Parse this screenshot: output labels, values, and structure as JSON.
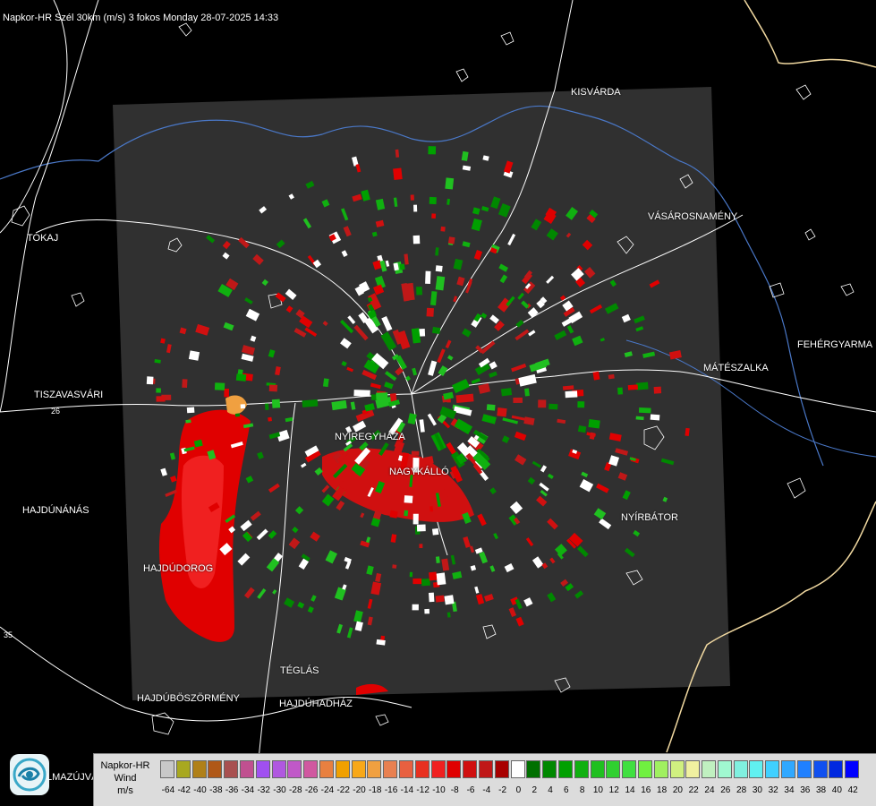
{
  "header": {
    "title": "Napkor-HR Szél 30km (m/s) 3 fokos Monday 28-07-2025 14:33"
  },
  "cities": [
    {
      "id": "kisvarda",
      "label": "KISVÁRDA"
    },
    {
      "id": "tokaj",
      "label": "TOKAJ"
    },
    {
      "id": "vasarosnameny",
      "label": "VÁSÁROSNAMÉNY"
    },
    {
      "id": "fehergyarmat",
      "label": "FEHÉRGYARMA"
    },
    {
      "id": "mateszalka",
      "label": "MÁTÉSZALKA"
    },
    {
      "id": "tiszavasvari",
      "label": "TISZAVASVÁRI"
    },
    {
      "id": "nyiregyhaza",
      "label": "NYÍREGYHÁZA"
    },
    {
      "id": "nagykallo",
      "label": "NAGYKÁLLÓ"
    },
    {
      "id": "hajdunanas",
      "label": "HAJDÚNÁNÁS"
    },
    {
      "id": "nyirbator",
      "label": "NYÍRBÁTOR"
    },
    {
      "id": "hajdudorog",
      "label": "HAJDÚDOROG"
    },
    {
      "id": "teglas",
      "label": "TÉGLÁS"
    },
    {
      "id": "hajduboszormeny",
      "label": "HAJDÚBÖSZÖRMÉNY"
    },
    {
      "id": "hajduhadhaz",
      "label": "HAJDÚHADHÁZ"
    }
  ],
  "road_numbers": [
    "26",
    "35"
  ],
  "legend": {
    "title_lines": [
      "Napkor-HR",
      "Wind",
      "m/s"
    ],
    "ticks": [
      "-64",
      "-42",
      "-40",
      "-38",
      "-36",
      "-34",
      "-32",
      "-30",
      "-28",
      "-26",
      "-24",
      "-22",
      "-20",
      "-18",
      "-16",
      "-14",
      "-12",
      "-10",
      "-8",
      "-6",
      "-4",
      "-2",
      "0",
      "2",
      "4",
      "6",
      "8",
      "10",
      "12",
      "14",
      "16",
      "18",
      "20",
      "22",
      "24",
      "26",
      "28",
      "30",
      "32",
      "34",
      "36",
      "38",
      "40",
      "42"
    ],
    "colors": [
      "#c8c8c8",
      "#a8a820",
      "#b08018",
      "#b05818",
      "#a85050",
      "#c05090",
      "#a050f0",
      "#b058e0",
      "#c058c8",
      "#d058a0",
      "#e88040",
      "#f0a000",
      "#f8a818",
      "#f0a040",
      "#e88050",
      "#e86040",
      "#e83020",
      "#f02020",
      "#e00000",
      "#d01010",
      "#c01818",
      "#a80000",
      "#ffffff",
      "#007000",
      "#008800",
      "#00a000",
      "#10b010",
      "#20c020",
      "#30d030",
      "#40e040",
      "#70f040",
      "#a0f060",
      "#d0f080",
      "#f0f0a0",
      "#c0f0c0",
      "#a0f8d0",
      "#80f0e0",
      "#60f0f0",
      "#40d0ff",
      "#30a8ff",
      "#2080ff",
      "#1050f0",
      "#0028e0",
      "#0000ff"
    ]
  },
  "logo": {
    "icon": "weather-service-logo-icon",
    "text": "LMAZÚJVÁR"
  },
  "colors": {
    "background": "#000000",
    "radar_area": "#303030",
    "river": "#4a78c8",
    "border": "#f0d8a0",
    "road": "#ffffff"
  }
}
